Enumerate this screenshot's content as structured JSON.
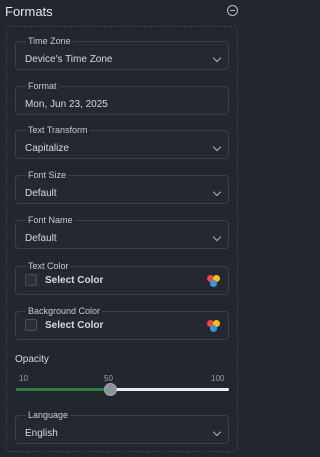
{
  "header": {
    "title": "Formats"
  },
  "fields": {
    "time_zone": {
      "label": "Time Zone",
      "value": "Device's Time Zone"
    },
    "format": {
      "label": "Format",
      "value": "Mon, Jun 23, 2025"
    },
    "text_transform": {
      "label": "Text Transform",
      "value": "Capitalize"
    },
    "font_size": {
      "label": "Font Size",
      "value": "Default"
    },
    "font_name": {
      "label": "Font Name",
      "value": "Default"
    },
    "text_color": {
      "label": "Text Color",
      "value": "Select Color"
    },
    "background_color": {
      "label": "Background Color",
      "value": "Select Color"
    },
    "language": {
      "label": "Language",
      "value": "English"
    }
  },
  "opacity": {
    "label": "Opacity",
    "min_label": "10",
    "mid_label": "50",
    "max_label": "100",
    "value": 50,
    "min": 10,
    "max": 100
  },
  "colors": {
    "background": "#22262e",
    "slider_fill": "#2f7d3e",
    "palette_dots": [
      "#e74c3c",
      "#f1c40f",
      "#3498db"
    ]
  }
}
